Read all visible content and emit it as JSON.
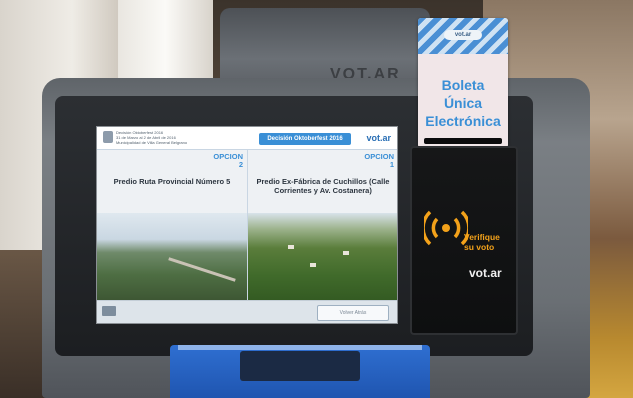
{
  "screen": {
    "header": {
      "election_title": "Decisión Oktoberfest 2016",
      "small_lines": [
        "Decisión Oktoberfest 2016",
        "31 de Marzo al 2 de Abril de 2016",
        "Municipalidad de Villa General Belgrano"
      ],
      "brand": "vot.ar"
    },
    "options": [
      {
        "label": "OPCION",
        "number": "2",
        "title": "Predio Ruta Provincial Número 5",
        "photo": "mountain-valley"
      },
      {
        "label": "OPCION",
        "number": "1",
        "title": "Predio Ex-Fábrica de Cuchillos (Calle Corrientes y Av. Costanera)",
        "photo": "forest-aerial"
      }
    ],
    "footer": {
      "button_label": "Volver Atrás"
    }
  },
  "card": {
    "brand": "vot.ar",
    "title_lines": [
      "Boleta",
      "Única",
      "Electrónica"
    ],
    "accent": "#3a8fd6"
  },
  "reader_panel": {
    "prompt_lines": [
      "Verifique",
      "su voto"
    ],
    "brand": "vot.ar",
    "accent": "#f3a21a"
  },
  "back_machine": {
    "engraved_text": "VOT.AR"
  },
  "icons": [
    "nfc-waves-icon",
    "crest-icon"
  ]
}
